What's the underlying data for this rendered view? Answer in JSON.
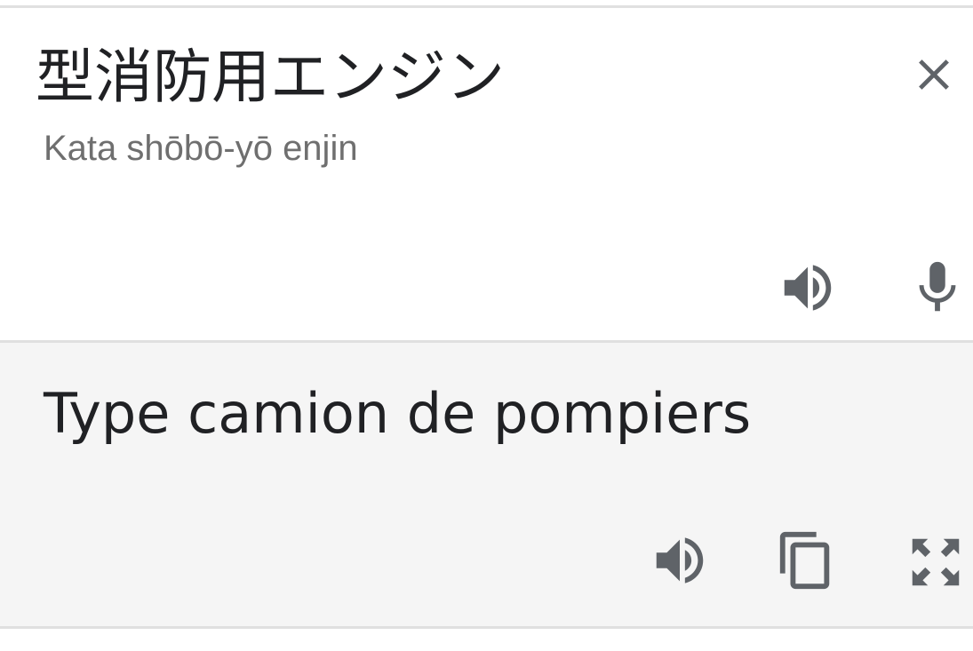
{
  "source": {
    "text": "型消防用エンジン",
    "romanization": "Kata shōbō-yō enjin",
    "icons": {
      "clear": "close-icon",
      "listen": "volume-icon",
      "voice_input": "microphone-icon"
    }
  },
  "translation": {
    "text": "Type camion de pompiers",
    "icons": {
      "listen": "volume-icon",
      "copy": "copy-icon",
      "fullscreen": "fullscreen-icon"
    }
  },
  "colors": {
    "text_primary": "#202124",
    "text_secondary": "#6f6f6f",
    "icon": "#5f6368",
    "translation_background": "#f5f5f5",
    "divider": "#e0e0e0"
  }
}
